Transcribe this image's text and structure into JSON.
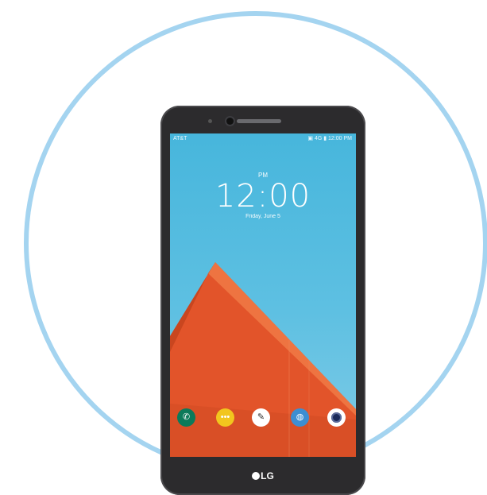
{
  "status_bar": {
    "carrier": "AT&T",
    "right_text": "▣ 4G ▮ 12:00 PM"
  },
  "lock_screen": {
    "ampm": "PM",
    "time": "12:00",
    "date": "Friday, June 5"
  },
  "dock": {
    "icons": [
      "phone-icon",
      "messages-icon",
      "compose-icon",
      "browser-icon",
      "camera-icon"
    ]
  },
  "brand": {
    "logo": "LG"
  },
  "colors": {
    "ring": "#a4d4f0",
    "screen_sky": "#5ec0e2",
    "wallpaper_orange": "#e2542a",
    "phone_body": "#2c2b2d"
  }
}
